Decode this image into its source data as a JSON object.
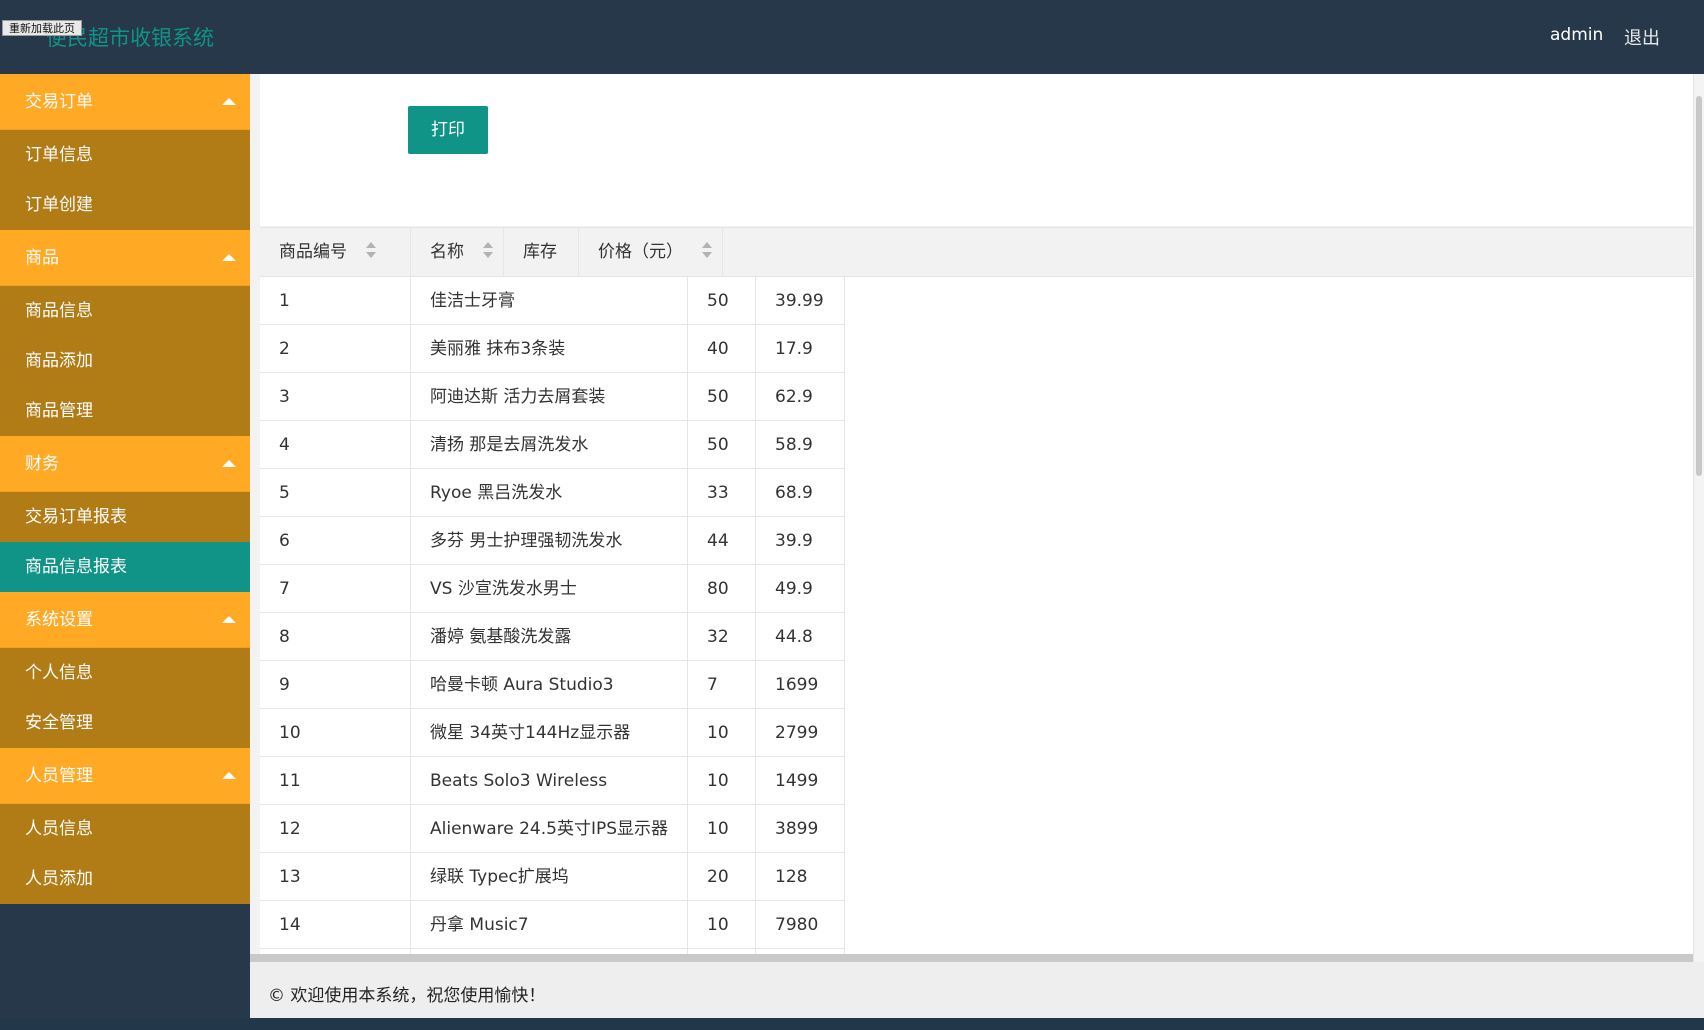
{
  "header": {
    "reload_label": "重新加载此页",
    "logo": "便民超市收银系统",
    "user": "admin",
    "logout": "退出"
  },
  "sidebar": {
    "groups": [
      {
        "title": "交易订单",
        "items": [
          "订单信息",
          "订单创建"
        ]
      },
      {
        "title": "商品",
        "items": [
          "商品信息",
          "商品添加",
          "商品管理"
        ]
      },
      {
        "title": "财务",
        "items": [
          "交易订单报表",
          "商品信息报表"
        ]
      },
      {
        "title": "系统设置",
        "items": [
          "个人信息",
          "安全管理"
        ]
      },
      {
        "title": "人员管理",
        "items": [
          "人员信息",
          "人员添加"
        ]
      }
    ],
    "active_item": "商品信息报表"
  },
  "toolbar": {
    "print_label": "打印"
  },
  "table": {
    "columns": [
      "商品编号",
      "名称",
      "库存",
      "价格（元）"
    ],
    "rows": [
      [
        "1",
        "佳洁士牙膏",
        "50",
        "39.99"
      ],
      [
        "2",
        "美丽雅 抹布3条装",
        "40",
        "17.9"
      ],
      [
        "3",
        "阿迪达斯 活力去屑套装",
        "50",
        "62.9"
      ],
      [
        "4",
        "清扬 那是去屑洗发水",
        "50",
        "58.9"
      ],
      [
        "5",
        "Ryoe 黑吕洗发水",
        "33",
        "68.9"
      ],
      [
        "6",
        "多芬 男士护理强韧洗发水",
        "44",
        "39.9"
      ],
      [
        "7",
        "VS 沙宣洗发水男士",
        "80",
        "49.9"
      ],
      [
        "8",
        "潘婷 氨基酸洗发露",
        "32",
        "44.8"
      ],
      [
        "9",
        "哈曼卡顿 Aura Studio3",
        "7",
        "1699"
      ],
      [
        "10",
        "微星 34英寸144Hz显示器",
        "10",
        "2799"
      ],
      [
        "11",
        "Beats Solo3 Wireless",
        "10",
        "1499"
      ],
      [
        "12",
        "Alienware 24.5英寸IPS显示器",
        "10",
        "3899"
      ],
      [
        "13",
        "绿联 Typec扩展坞",
        "20",
        "128"
      ],
      [
        "14",
        "丹拿 Music7",
        "10",
        "7980"
      ]
    ]
  },
  "footer": {
    "text": "© 欢迎使用本系统，祝您使用愉快！"
  }
}
